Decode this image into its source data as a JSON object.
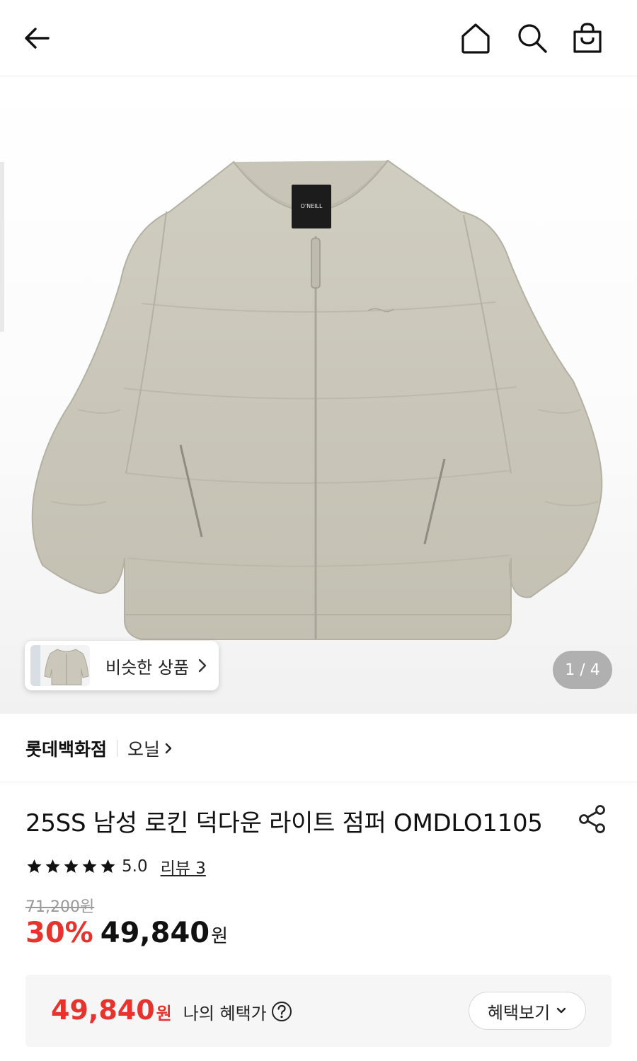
{
  "header": {
    "back_icon": "arrow-left-icon",
    "home_icon": "home-icon",
    "search_icon": "search-icon",
    "cart_icon": "shopping-bag-icon"
  },
  "gallery": {
    "similar_label": "비슷한 상품",
    "page_indicator": "1 / 4",
    "logo_text": "O'NEILL"
  },
  "brand_row": {
    "store": "롯데백화점",
    "brand": "오닐"
  },
  "product": {
    "title": "25SS 남성 로킨 덕다운 라이트 점퍼 OMDLO1105",
    "rating": "5.0",
    "rating_stars": 5,
    "review_link": "리뷰 3",
    "original_price": "71,200원",
    "discount": "30%",
    "sale_price": "49,840",
    "sale_unit": "원"
  },
  "benefit": {
    "price": "49,840",
    "unit": "원",
    "label": "나의 혜택가",
    "button": "혜택보기"
  },
  "colors": {
    "accent_red": "#e8322d",
    "jacket": "#ccc9bc"
  }
}
